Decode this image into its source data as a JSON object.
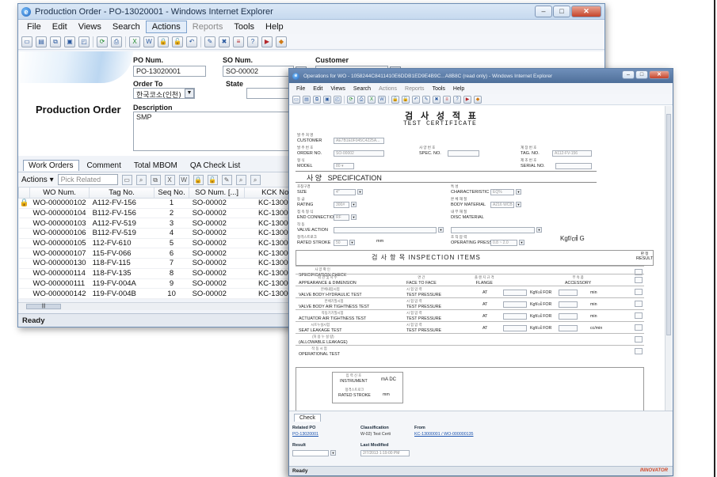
{
  "win1": {
    "title": "Production Order - PO-13020001 - Windows Internet Explorer",
    "menu": [
      "File",
      "Edit",
      "Views",
      "Search",
      "Actions",
      "Reports",
      "Tools",
      "Help"
    ],
    "fields": {
      "po_num_label": "PO Num.",
      "po_num_value": "PO-13020001",
      "so_num_label": "SO Num.",
      "so_num_value": "SO-00002",
      "customer_label": "Customer",
      "order_to_label": "Order To",
      "order_to_value": "한국코소(인천)",
      "state_label": "State",
      "description_label": "Description",
      "description_value": "SMP"
    },
    "page_title": "Production Order",
    "tabs": [
      "Work Orders",
      "Comment",
      "Total MBOM",
      "QA Check List"
    ],
    "grid_actions_label": "Actions ▾",
    "pick_related_placeholder": "Pick Related",
    "columns": [
      "WO Num.",
      "Tag No.",
      "Seq No.",
      "SO Num. [...]",
      "KCK No."
    ],
    "rows": [
      [
        "WO-000000102",
        "A112-FV-156",
        "1",
        "SO-00002",
        "KC-13000001"
      ],
      [
        "WO-000000104",
        "B112-FV-156",
        "2",
        "SO-00002",
        "KC-13000001"
      ],
      [
        "WO-000000103",
        "A112-FV-519",
        "3",
        "SO-00002",
        "KC-13000001"
      ],
      [
        "WO-000000106",
        "B112-FV-519",
        "4",
        "SO-00002",
        "KC-13000001"
      ],
      [
        "WO-000000105",
        "112-FV-610",
        "5",
        "SO-00002",
        "KC-13000001"
      ],
      [
        "WO-000000107",
        "115-FV-066",
        "6",
        "SO-00002",
        "KC-13000001"
      ],
      [
        "WO-000000130",
        "118-FV-115",
        "7",
        "SO-00002",
        "KC-13000001"
      ],
      [
        "WO-000000114",
        "118-FV-135",
        "8",
        "SO-00002",
        "KC-13000001"
      ],
      [
        "WO-000000111",
        "119-FV-004A",
        "9",
        "SO-00002",
        "KC-13000001"
      ],
      [
        "WO-000000142",
        "119-FV-004B",
        "10",
        "SO-00002",
        "KC-13000001"
      ]
    ],
    "status": "Ready"
  },
  "win2": {
    "title": "Operations for WO - 1058244C8411410E6DDB1ED9E4B9C...A8B8C (read only) - Windows Internet Explorer",
    "menu": [
      "File",
      "Edit",
      "Views",
      "Search",
      "Actions",
      "Reports",
      "Tools",
      "Help"
    ],
    "cert_title_ko": "검 사 성 적 표",
    "cert_title_en": "TEST  CERTIFICATE",
    "customer_ko": "발 주 처 명",
    "customer_en": "CUSTOMER",
    "customer_value": "AE7B1E0F045C4225A...",
    "order_no_ko": "발 주 번 호",
    "order_no_en": "ORDER  NO.",
    "order_no_value": "SO-00002",
    "spec_no_ko": "사 양 번 호",
    "spec_no_en": "SPEC.  NO.",
    "tag_no_ko": "계 장 번 호",
    "tag_no_en": "TAG.  NO.",
    "tag_no_value": "A112-FV-156",
    "model_ko": "형 식",
    "model_en": "MODEL",
    "model_value": "80 ▾",
    "serial_ko": "제 조 번 호",
    "serial_en": "SERIAL  NO.",
    "spec_ko": "사  양",
    "spec_en": "SPECIFICATION",
    "size_ko": "호칭구경",
    "size_en": "SIZE",
    "size_value": "4\"",
    "char_ko": "특 성",
    "char_en": "CHARACTERISTIC",
    "char_value": "EQ%",
    "rating_ko": "등 급",
    "rating_en": "RATING",
    "rating_value": "300#",
    "body_mat_ko": "본 체 재 질",
    "body_mat_en": "BODY  MATERIAL",
    "body_mat_value": "A216 WCB",
    "end_conn_ko": "접 속 형 식",
    "end_conn_en": "END CONNECTION",
    "end_conn_value": "RF",
    "disc_mat_ko": "내 부 재 질",
    "disc_mat_en": "DISC  MATERIAL",
    "valve_action_ko": "작 동",
    "valve_action_en": "VALVE ACTION",
    "rated_stroke_ko": "정격스트로크",
    "rated_stroke_en": "RATED  STROKE",
    "rated_stroke_value": "50",
    "rated_stroke_unit": "mm",
    "op_pressure_ko": "조 작 압 력",
    "op_pressure_en": "OPERATING PRESSURE",
    "op_pressure_value": "0.8 ~ 2.0",
    "op_pressure_unit": "Kgf/㎠ G",
    "insp_title": "검  사  항  목     INSPECTION   ITEMS",
    "result_ko": "판 정",
    "result_en": "RESULT",
    "rows": [
      {
        "ko": "사 양 확 인",
        "en": "SPECIFICATION  CHECK"
      },
      {
        "ko": "외 관 및 치 수",
        "en": "APPEARANCE  &  DIMENSION"
      },
      {
        "ko": "본체내압시험",
        "en": "VALVE  BODY  HYDRAULIC  TEST"
      },
      {
        "ko": "본체기밀시험",
        "en": "VALVE  BODY AIR TIGHTNESS TEST"
      },
      {
        "ko": "작동기기밀시험",
        "en": "ACTUATOR AIR TIGHTNESS  TEST"
      },
      {
        "ko": "시트누설시험",
        "en": "SEAT     LEAKAGE     TEST"
      },
      {
        "ko": "(허 용 누 설 량)",
        "en": "(ALLOWABLE  LEAKAGE)"
      },
      {
        "ko": "작 동 시 험",
        "en": "OPERATIONAL    TEST"
      }
    ],
    "face_ko": "면 간",
    "face_en": "FACE  TO  FACE",
    "flange_ko": "플 랜 지 규 격",
    "flange_en": "FLANGE",
    "accessory_ko": "부 속 품",
    "accessory_en": "ACCESSORY",
    "test_pressure_en": "TEST PRESSURE",
    "test_pressure_ko": "시 험 압 력",
    "at": "AT",
    "kgf_for": "Kgf/㎠ FOR",
    "min": "min",
    "cc_min": "cc/min",
    "instrument_ko": "입 력 신 호",
    "instrument_en": "INSTRUMENT",
    "instrument_value": "mA DC",
    "stroke_ko": "정격스트로크",
    "stroke_en": "RATED STROKE",
    "stroke_unit": "mm",
    "check_tab": "Check",
    "related_po_label": "Related PO",
    "related_po_value": "PO-13020001",
    "classification_label": "Classification",
    "classification_value": "W-02) Test Certi",
    "from_label": "From",
    "from_value": "KC-13000001 / WO-000000135",
    "result_label": "Result",
    "last_modified_label": "Last Modified",
    "last_modified_value": "2/7/2013 1:19:00 PM",
    "status": "Ready",
    "brand": "INNOVATOR"
  },
  "colors": {
    "ie_title": "#c6d9ef",
    "link": "#1f56b0",
    "brand": "#d14a2a"
  }
}
